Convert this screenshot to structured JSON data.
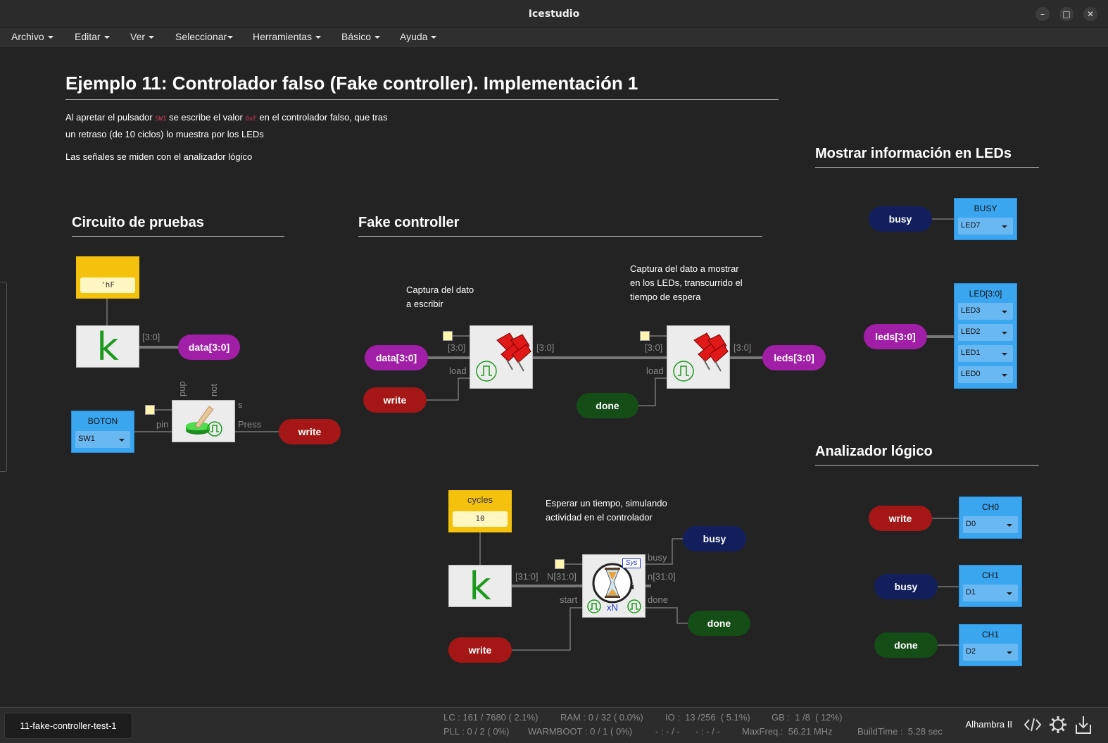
{
  "window": {
    "title": "Icestudio",
    "minimize": "–",
    "maximize": "□",
    "close": "✕"
  },
  "menu": [
    {
      "label": "Archivo"
    },
    {
      "label": "Editar"
    },
    {
      "label": "Ver"
    },
    {
      "label": "Seleccionar"
    },
    {
      "label": "Herramientas"
    },
    {
      "label": "Básico"
    },
    {
      "label": "Ayuda"
    }
  ],
  "doc": {
    "title": "Ejemplo 11: Controlador falso (Fake controller). Implementación 1",
    "desc_part1": "Al apretar el pulsador",
    "desc_code1": "SW1",
    "desc_part2": "se escribe el valor",
    "desc_code2": "0xF",
    "desc_part3": "en el controlador falso, que tras",
    "desc_line2": "un retraso (de 10 ciclos) lo muestra por los LEDs",
    "desc_line3": "Las señales se miden con el analizador lógico"
  },
  "sections": {
    "test": "Circuito de pruebas",
    "fake": "Fake controller",
    "leds": "Mostrar información en LEDs",
    "analyzer": "Analizador lógico"
  },
  "test_circuit": {
    "const_value": "'hF",
    "k_label": "k",
    "bus_label": "[3:0]",
    "data_label": "data[3:0]",
    "boton_label": "BOTON",
    "boton_pin": "SW1",
    "pin_label": "pin",
    "pup_label": "pup",
    "not_label": "not",
    "s_label": "s",
    "press_label": "Press",
    "write_label": "write"
  },
  "fake_controller": {
    "comment1_line1": "Captura del dato",
    "comment1_line2": "a escribir",
    "comment2_line1": "Captura del dato a mostrar",
    "comment2_line2": "en los LEDs, transcurrido el",
    "comment2_line3": "tiempo de espera",
    "data_in": "data[3:0]",
    "write": "write",
    "done": "done",
    "leds_out": "leds[3:0]",
    "bus_in1": "[3:0]",
    "bus_out1": "[3:0]",
    "bus_in2": "[3:0]",
    "bus_out2": "[3:0]",
    "load1": "load",
    "load2": "load",
    "cycles_label": "cycles",
    "cycles_value": "10",
    "k_label": "k",
    "bus32": "[31:0]",
    "n_in": "N[31:0]",
    "n_out": "n[31:0]",
    "busy_port": "busy",
    "done_port": "done",
    "start_port": "start",
    "sys_label": "Sys",
    "xn_label": "xN",
    "comment3_line1": "Esperar un tiempo, simulando",
    "comment3_line2": "actividad en el controlador",
    "busy_out": "busy",
    "done_out": "done",
    "write_in": "write"
  },
  "leds_panel": {
    "busy_pill": "busy",
    "busy_block": "BUSY",
    "busy_pin": "LED7",
    "leds_pill": "leds[3:0]",
    "leds_block": "LED[3:0]",
    "leds_pins": [
      "LED3",
      "LED2",
      "LED1",
      "LED0"
    ]
  },
  "analyzer": {
    "rows": [
      {
        "pill": "write",
        "block": "CH0",
        "pin": "D0"
      },
      {
        "pill": "busy",
        "block": "CH1",
        "pin": "D1"
      },
      {
        "pill": "done",
        "block": "CH1",
        "pin": "D2"
      }
    ]
  },
  "status": {
    "project": "11-fake-controller-test-1",
    "lc": "LC : 161 / 7680 ( 2.1%)",
    "ram": "RAM : 0 / 32 ( 0.0%)",
    "io": "IO :  13 /256  ( 5.1%)",
    "gb": "GB :  1 /8  ( 12%)",
    "pll": "PLL : 0 / 2 ( 0%)",
    "warmboot": "WARMBOOT : 0 / 1 ( 0%)",
    "dash1": "- : - / -",
    "dash2": "- : - / -",
    "maxfreq": "MaxFreq.:  56.21 MHz",
    "buildtime": "BuildTime :  5.28 sec",
    "board": "Alhambra II"
  },
  "colors": {
    "purple": "#a11ea6",
    "red": "#a51616",
    "navy": "#121f5c",
    "green": "#154d17",
    "yellow": "#f4c20d",
    "blue": "#3ba6f0"
  },
  "icons": [
    "code-icon",
    "gear-icon",
    "upload-icon",
    "pin-icon",
    "timer-icon",
    "button-icon"
  ]
}
